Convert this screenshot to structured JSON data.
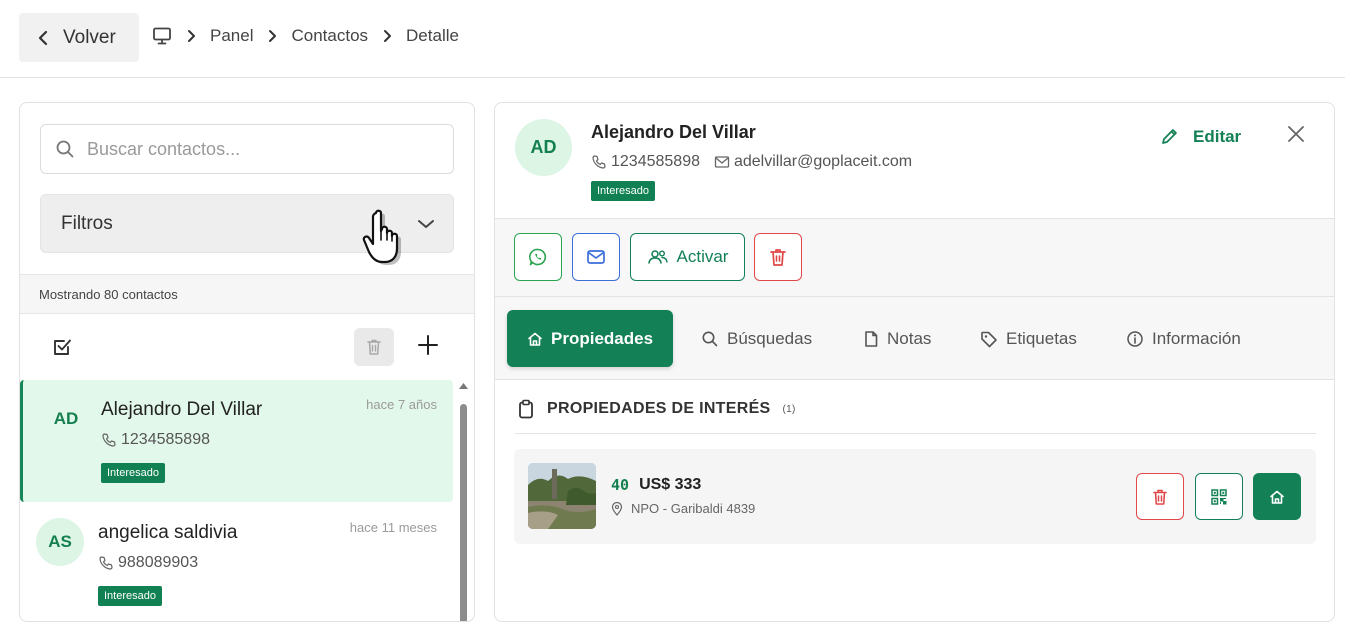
{
  "topbar": {
    "back_label": "Volver",
    "breadcrumb": [
      "Panel",
      "Contactos",
      "Detalle"
    ]
  },
  "left": {
    "search_placeholder": "Buscar contactos...",
    "filters_label": "Filtros",
    "count_text": "Mostrando 80 contactos",
    "contacts": [
      {
        "initials": "AD",
        "name": "Alejandro Del Villar",
        "time": "hace 7 años",
        "phone": "1234585898",
        "status": "Interesado"
      },
      {
        "initials": "AS",
        "name": "angelica saldivia",
        "time": "hace 11 meses",
        "phone": "988089903",
        "status": "Interesado"
      }
    ]
  },
  "detail": {
    "initials": "AD",
    "name": "Alejandro Del Villar",
    "phone": "1234585898",
    "email": "adelvillar@goplaceit.com",
    "status": "Interesado",
    "edit_label": "Editar",
    "actions": {
      "activate_label": "Activar"
    },
    "tabs": [
      "Propiedades",
      "Búsquedas",
      "Notas",
      "Etiquetas",
      "Información"
    ],
    "section_title": "PROPIEDADES DE INTERÉS",
    "section_count": "(1)",
    "property": {
      "id": "40",
      "price": "US$ 333",
      "address": "NPO - Garibaldi 4839"
    }
  },
  "colors": {
    "brand_green": "#138056",
    "badge_green": "#118052",
    "active_row_bg": "#e2f8ea",
    "whatsapp": "#2aa44f",
    "email_blue": "#3b6fd8",
    "danger_red": "#e04848"
  },
  "icons": {
    "back": "chevron-left-icon",
    "breadcrumb_root": "monitor-icon",
    "search": "search-icon",
    "filters": "chevron-down-icon",
    "select_all": "checkbox-icon",
    "bulk_delete": "trash-icon",
    "add": "plus-icon",
    "phone": "phone-icon",
    "email": "mail-icon",
    "edit": "pencil-icon",
    "close": "close-icon",
    "whatsapp": "whatsapp-icon",
    "activate": "users-icon",
    "tab_properties": "home-icon",
    "tab_searches": "search-icon",
    "tab_notes": "file-icon",
    "tab_tags": "tag-icon",
    "tab_info": "info-icon",
    "section": "clipboard-icon",
    "location": "pin-icon",
    "qr": "qr-icon"
  }
}
